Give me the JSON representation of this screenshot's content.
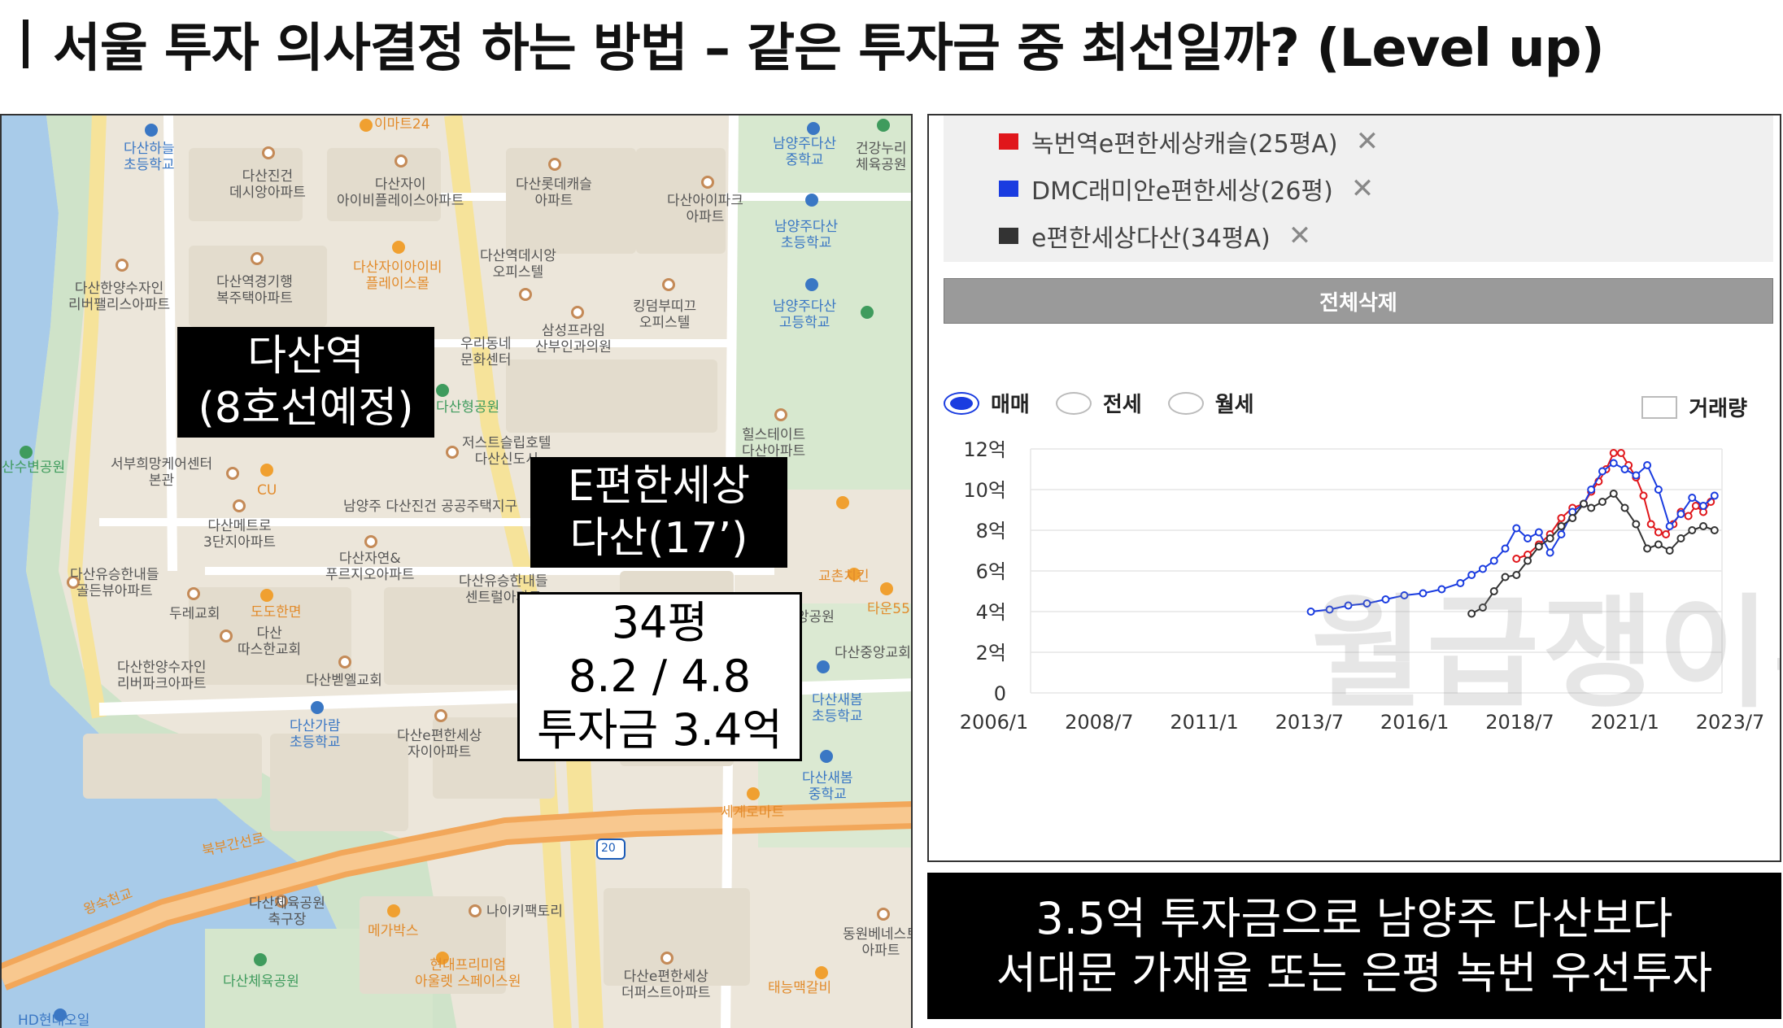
{
  "title": "서울 투자 의사결정 하는 방법 – 같은 투자금 중 최선일까? (Level up)",
  "map": {
    "callouts": {
      "station_line1": "다산역",
      "station_line2": "(8호선예정)",
      "apt_line1": "E편한세상",
      "apt_line2": "다산(17’)",
      "info_line1": "34평",
      "info_line2": "8.2 / 4.8",
      "info_line3": "투자금 3.4억"
    },
    "labels": [
      {
        "text": "이마트24",
        "color": "orange"
      },
      {
        "text": "다산하늘\n초등학교",
        "color": "blue"
      },
      {
        "text": "다산진건\n데시앙아파트",
        "color": "gray"
      },
      {
        "text": "다산자이\n아이비플레이스아파트",
        "color": "gray"
      },
      {
        "text": "다산롯데캐슬\n아파트",
        "color": "gray"
      },
      {
        "text": "다산아이파크\n아파트",
        "color": "gray"
      },
      {
        "text": "다산한양수자인\n리버팰리스아파트",
        "color": "gray"
      },
      {
        "text": "다산역경기행\n복주택아파트",
        "color": "gray"
      },
      {
        "text": "다산자이아이비\n플레이스몰",
        "color": "orange"
      },
      {
        "text": "다산역데시앙\n오피스텔",
        "color": "gray"
      },
      {
        "text": "남양주다산\n중학교",
        "color": "blue"
      },
      {
        "text": "남양주다산\n초등학교",
        "color": "blue"
      },
      {
        "text": "남양주다산\n고등학교",
        "color": "blue"
      },
      {
        "text": "건강누리\n체육공원",
        "color": "green"
      },
      {
        "text": "킹덤부띠끄\n오피스텔",
        "color": "gray"
      },
      {
        "text": "삼성프라임\n산부인과의원",
        "color": "gray"
      },
      {
        "text": "우리동네\n문화센터",
        "color": "gray"
      },
      {
        "text": "서부희망케어센터\n본관",
        "color": "gray"
      },
      {
        "text": "산수변공원",
        "color": "green"
      },
      {
        "text": "다산메트로\n3단지아파트",
        "color": "gray"
      },
      {
        "text": "다산자연&\n푸르지오아파트",
        "color": "gray"
      },
      {
        "text": "다산유승한내들\n골든뷰아파트",
        "color": "gray"
      },
      {
        "text": "다산유승한내들\n센트럴아파트",
        "color": "gray"
      },
      {
        "text": "두레교회",
        "color": "gray"
      },
      {
        "text": "도도한면",
        "color": "orange"
      },
      {
        "text": "다산\n따스한교회",
        "color": "gray"
      },
      {
        "text": "다산한양수자인\n리버파크아파트",
        "color": "gray"
      },
      {
        "text": "다산벧엘교회",
        "color": "gray"
      },
      {
        "text": "다산가람\n초등학교",
        "color": "blue"
      },
      {
        "text": "다산e편한세상\n자이아파트",
        "color": "gray"
      },
      {
        "text": "힐스테이트\n다산아파트",
        "color": "gray"
      },
      {
        "text": "교촌치킨",
        "color": "orange"
      },
      {
        "text": "다산중앙교회",
        "color": "gray"
      },
      {
        "text": "다산새봄\n초등학교",
        "color": "blue"
      },
      {
        "text": "다산새봄\n중학교",
        "color": "blue"
      },
      {
        "text": "세계로마트",
        "color": "orange"
      },
      {
        "text": "북부간선로",
        "color": "orange"
      },
      {
        "text": "왕숙천교",
        "color": "orange"
      },
      {
        "text": "다산체육공원\n축구장",
        "color": "gray"
      },
      {
        "text": "다산체육공원",
        "color": "green"
      },
      {
        "text": "메가박스",
        "color": "orange"
      },
      {
        "text": "나이키팩토리",
        "color": "gray"
      },
      {
        "text": "현대프리미엄\n아울렛 스페이스원",
        "color": "orange"
      },
      {
        "text": "다산e편한세상\n더퍼스트아파트",
        "color": "gray"
      },
      {
        "text": "동원베네스트\n아파트",
        "color": "gray"
      },
      {
        "text": "태능맥갈비",
        "color": "orange"
      },
      {
        "text": "HD현대오일",
        "color": "blue"
      },
      {
        "text": "남양주 다산진건 공공주택지구",
        "color": "gray"
      },
      {
        "text": "저스트슬립호텔\n다산신도시",
        "color": "gray"
      },
      {
        "text": "다산형공원",
        "color": "green"
      },
      {
        "text": "다산중앙공원",
        "color": "gray"
      },
      {
        "text": "CU",
        "color": "orange"
      },
      {
        "text": "타운55",
        "color": "orange"
      }
    ],
    "road_number": "20"
  },
  "chart_panel": {
    "legend": [
      {
        "label": "녹번역e편한세상캐슬(25평A)",
        "color": "#e0161b",
        "close": "✕"
      },
      {
        "label": "DMC래미안e편한세상(26평)",
        "color": "#1a3ce0",
        "close": "✕"
      },
      {
        "label": "e편한세상다산(34평A)",
        "color": "#333333",
        "close": "✕"
      }
    ],
    "delete_all": "전체삭제",
    "radios": [
      {
        "label": "매매",
        "selected": true
      },
      {
        "label": "전세",
        "selected": false
      },
      {
        "label": "월세",
        "selected": false
      }
    ],
    "volume_checkbox": {
      "label": "거래량",
      "checked": false
    },
    "watermark": "월급쟁이부자들"
  },
  "chart_data": {
    "type": "line",
    "title": "",
    "xlabel": "",
    "ylabel": "",
    "x_ticks": [
      "2006/1",
      "2008/7",
      "2011/1",
      "2013/7",
      "2016/1",
      "2018/7",
      "2021/1",
      "2023/7"
    ],
    "y_ticks": [
      "0",
      "2억",
      "4억",
      "6억",
      "8억",
      "10억",
      "12억"
    ],
    "ylim": [
      0,
      12
    ],
    "xlim": [
      2006.0,
      2024.5
    ],
    "grid": true,
    "series": [
      {
        "name": "녹번역e편한세상캐슬(25평A)",
        "color": "#e0161b",
        "x": [
          2019.0,
          2019.3,
          2019.6,
          2019.9,
          2020.2,
          2020.5,
          2020.8,
          2021.0,
          2021.2,
          2021.4,
          2021.6,
          2021.8,
          2022.0,
          2022.2,
          2022.4,
          2022.6,
          2022.8,
          2023.0,
          2023.2,
          2023.4,
          2023.6,
          2023.8,
          2024.0,
          2024.2
        ],
        "y": [
          6.6,
          6.8,
          7.3,
          7.8,
          8.6,
          9.1,
          9.3,
          9.9,
          10.4,
          11.0,
          11.8,
          11.8,
          11.2,
          10.6,
          9.7,
          8.3,
          7.9,
          7.8,
          8.3,
          8.9,
          8.7,
          9.2,
          8.9,
          9.4
        ]
      },
      {
        "name": "DMC래미안e편한세상(26평)",
        "color": "#1a3ce0",
        "x": [
          2013.5,
          2014.0,
          2014.5,
          2015.0,
          2015.5,
          2016.0,
          2016.5,
          2017.0,
          2017.5,
          2017.8,
          2018.1,
          2018.4,
          2018.7,
          2019.0,
          2019.3,
          2019.6,
          2019.9,
          2020.2,
          2020.5,
          2020.8,
          2021.0,
          2021.3,
          2021.6,
          2021.9,
          2022.2,
          2022.5,
          2022.8,
          2023.1,
          2023.4,
          2023.7,
          2024.0,
          2024.3
        ],
        "y": [
          4.0,
          4.1,
          4.3,
          4.4,
          4.6,
          4.8,
          4.9,
          5.1,
          5.4,
          5.8,
          6.1,
          6.5,
          7.1,
          8.1,
          7.6,
          7.9,
          6.9,
          7.8,
          8.9,
          9.3,
          10.0,
          10.9,
          11.3,
          11.0,
          10.7,
          11.2,
          10.0,
          8.2,
          8.8,
          9.6,
          9.2,
          9.7
        ]
      },
      {
        "name": "e편한세상다산(34평A)",
        "color": "#333333",
        "x": [
          2017.8,
          2018.1,
          2018.4,
          2018.7,
          2019.0,
          2019.3,
          2019.6,
          2019.9,
          2020.2,
          2020.5,
          2020.8,
          2021.0,
          2021.3,
          2021.6,
          2021.9,
          2022.2,
          2022.5,
          2022.8,
          2023.1,
          2023.4,
          2023.7,
          2024.0,
          2024.3
        ],
        "y": [
          3.9,
          4.2,
          5.0,
          5.7,
          5.8,
          6.5,
          7.2,
          7.6,
          8.2,
          8.6,
          9.3,
          9.1,
          9.4,
          9.8,
          9.1,
          8.3,
          7.1,
          7.3,
          7.0,
          7.6,
          8.0,
          8.2,
          8.0
        ]
      }
    ]
  },
  "conclusion": {
    "line1": "3.5억 투자금으로 남양주 다산보다",
    "line2": "서대문 가재울 또는 은평 녹번 우선투자"
  }
}
